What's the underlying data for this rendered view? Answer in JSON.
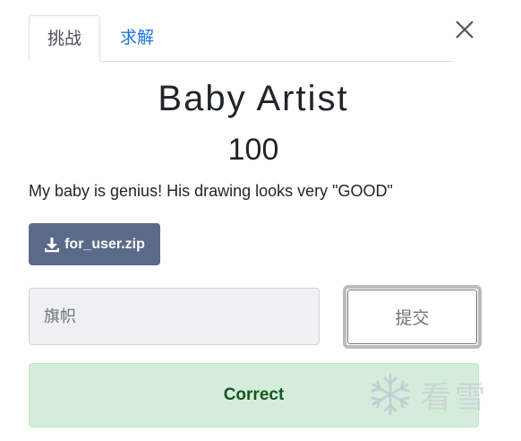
{
  "tabs": [
    {
      "label": "挑战",
      "active": true
    },
    {
      "label": "求解",
      "active": false
    }
  ],
  "challenge": {
    "title": "Baby Artist",
    "points": "100",
    "description": "My baby is genius! His drawing looks very \"GOOD\"",
    "file_label": "for_user.zip"
  },
  "form": {
    "flag_placeholder": "旗帜",
    "flag_value": "",
    "submit_label": "提交"
  },
  "result": {
    "message": "Correct"
  },
  "watermark": {
    "text": "看雪"
  },
  "colors": {
    "accent": "#1a73e8",
    "file_button": "#5a6b8a",
    "success_bg": "#d4edda",
    "success_text": "#155724"
  },
  "icons": {
    "close": "close-icon",
    "download": "download-icon",
    "watermark": "snowflake-icon"
  }
}
